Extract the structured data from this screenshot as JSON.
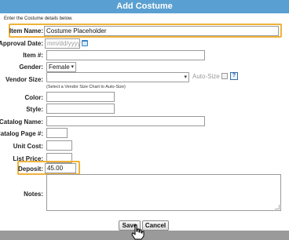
{
  "dialog": {
    "title": "Add Costume",
    "intro": "Enter the Costume details below."
  },
  "form": {
    "item_name": {
      "label": "Item Name:",
      "value": "Costume Placeholder"
    },
    "approval_date": {
      "label": "Approval Date:",
      "placeholder": "mm/dd/yyyy"
    },
    "item_number": {
      "label": "Item #:",
      "value": ""
    },
    "gender": {
      "label": "Gender:",
      "value": "Female",
      "options": [
        "Female"
      ]
    },
    "vendor_size": {
      "label": "Vendor Size:",
      "value": "",
      "note": "(Select a Vendor Size Chart to Auto-Size)",
      "auto_size_label": "Auto-Size",
      "help": "?"
    },
    "color": {
      "label": "Color:",
      "value": ""
    },
    "style": {
      "label": "Style:",
      "value": ""
    },
    "catalog_name": {
      "label": "Catalog Name:",
      "value": ""
    },
    "catalog_page": {
      "label": "Catalog Page #:",
      "value": ""
    },
    "unit_cost": {
      "label": "Unit Cost:",
      "value": ""
    },
    "list_price": {
      "label": "List Price:",
      "value": ""
    },
    "deposit": {
      "label": "Deposit:",
      "value": "45.00"
    },
    "notes": {
      "label": "Notes:",
      "value": ""
    }
  },
  "buttons": {
    "save": "Save",
    "cancel": "Cancel"
  },
  "icons": {
    "calendar": "calendar-icon",
    "help": "help-icon",
    "cursor": "hand-cursor-icon"
  },
  "colors": {
    "header": "#5a9fd1",
    "highlight": "#f0b23a",
    "footer": "#9a9a9a"
  }
}
